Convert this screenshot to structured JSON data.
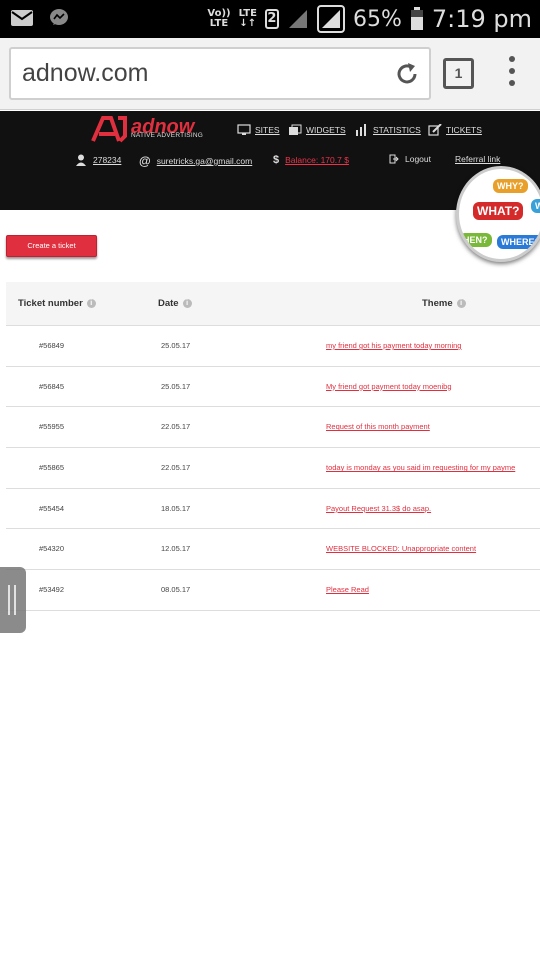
{
  "status_bar": {
    "network_label_top": "Vo))",
    "network_label_bottom": "LTE",
    "lte_label": "LTE",
    "sim_slot": "2",
    "battery": "65%",
    "time": "7:19 pm",
    "icons": [
      "mail-icon",
      "messenger-icon",
      "signal-icon",
      "battery-icon"
    ]
  },
  "browser": {
    "url": "adnow.com",
    "tab_count": "1"
  },
  "header": {
    "logo_text": "adnow",
    "logo_tagline": "NATIVE ADVERTISING",
    "nav": [
      {
        "label": "SITES"
      },
      {
        "label": "WIDGETS"
      },
      {
        "label": "STATISTICS"
      },
      {
        "label": "TICKETS"
      }
    ],
    "user_id": "278234",
    "email": "suretricks.ga@gmail.com",
    "balance": "Balance: 170.7 $",
    "logout": "Logout",
    "referral": "Referral link"
  },
  "badge": {
    "words": [
      "WHY?",
      "WHAT?",
      "WH",
      "HEN?",
      "WHERE?"
    ]
  },
  "create_ticket": "Create a ticket",
  "table": {
    "headers": [
      "Ticket number",
      "Date",
      "Theme"
    ],
    "rows": [
      {
        "number": "#56849",
        "date": "25.05.17",
        "theme": "my friend got his payment today morning"
      },
      {
        "number": "#56845",
        "date": "25.05.17",
        "theme": "My friend got payment today moenibg"
      },
      {
        "number": "#55955",
        "date": "22.05.17",
        "theme": "Request of this month payment"
      },
      {
        "number": "#55865",
        "date": "22.05.17",
        "theme": "today is monday as you said im requesting for my payme"
      },
      {
        "number": "#55454",
        "date": "18.05.17",
        "theme": "Payout Request 31.3$ do asap."
      },
      {
        "number": "#54320",
        "date": "12.05.17",
        "theme": "WEBSITE BLOCKED: Unappropriate content"
      },
      {
        "number": "#53492",
        "date": "08.05.17",
        "theme": "Please Read"
      }
    ]
  },
  "colors": {
    "accent": "#e0303f",
    "header_bg": "#111111",
    "status_bg": "#000000"
  }
}
